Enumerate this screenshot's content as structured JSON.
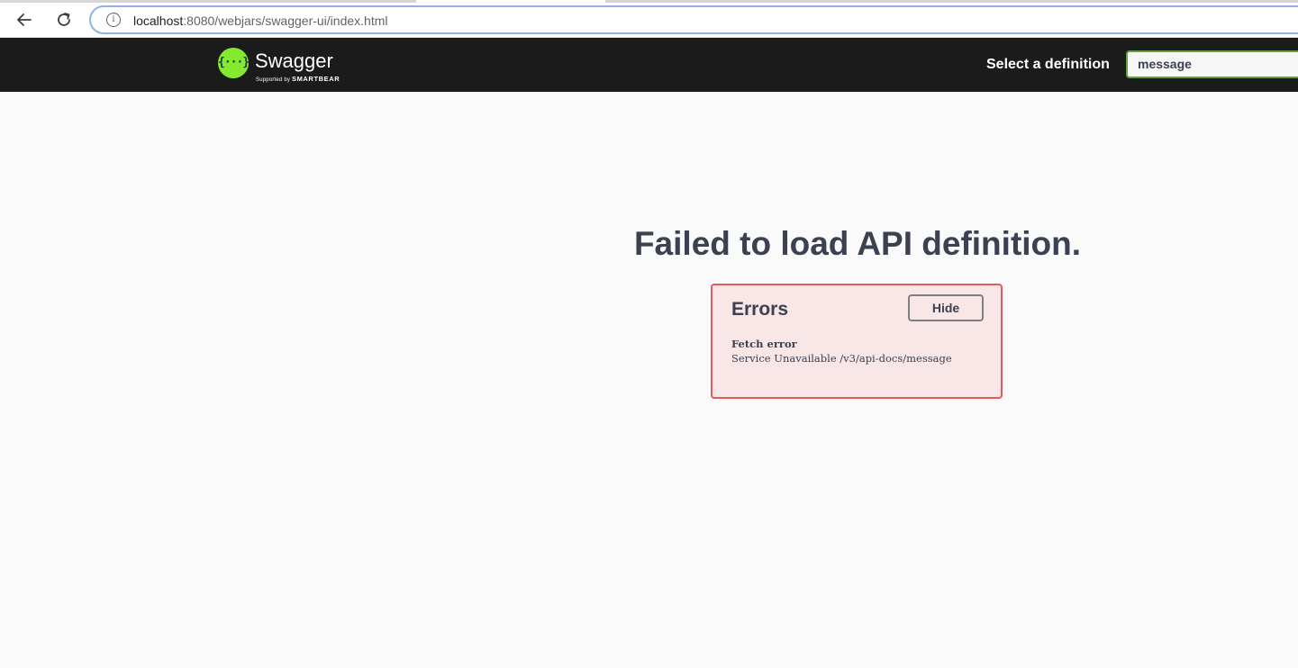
{
  "browser": {
    "url_host": "localhost",
    "url_rest": ":8080/webjars/swagger-ui/index.html",
    "back_icon": "arrow-left-icon",
    "reload_icon": "reload-icon",
    "info_icon": "info-icon",
    "info_glyph": "i"
  },
  "topbar": {
    "logo_glyph": "{···}",
    "logo_name": "Swagger",
    "logo_sub_prefix": "Supported by",
    "logo_sub_brand": "SMARTBEAR",
    "select_label": "Select a definition",
    "selected_definition": "message",
    "accent_color": "#85ea2d",
    "select_border_color": "#62a03f"
  },
  "main": {
    "title": "Failed to load API definition.",
    "errors": {
      "heading": "Errors",
      "hide_label": "Hide",
      "error_name": "Fetch error",
      "error_message": "Service Unavailable /v3/api-docs/message",
      "box_bg_color": "#f9e6e6",
      "box_border_color": "#e45a5a"
    }
  }
}
